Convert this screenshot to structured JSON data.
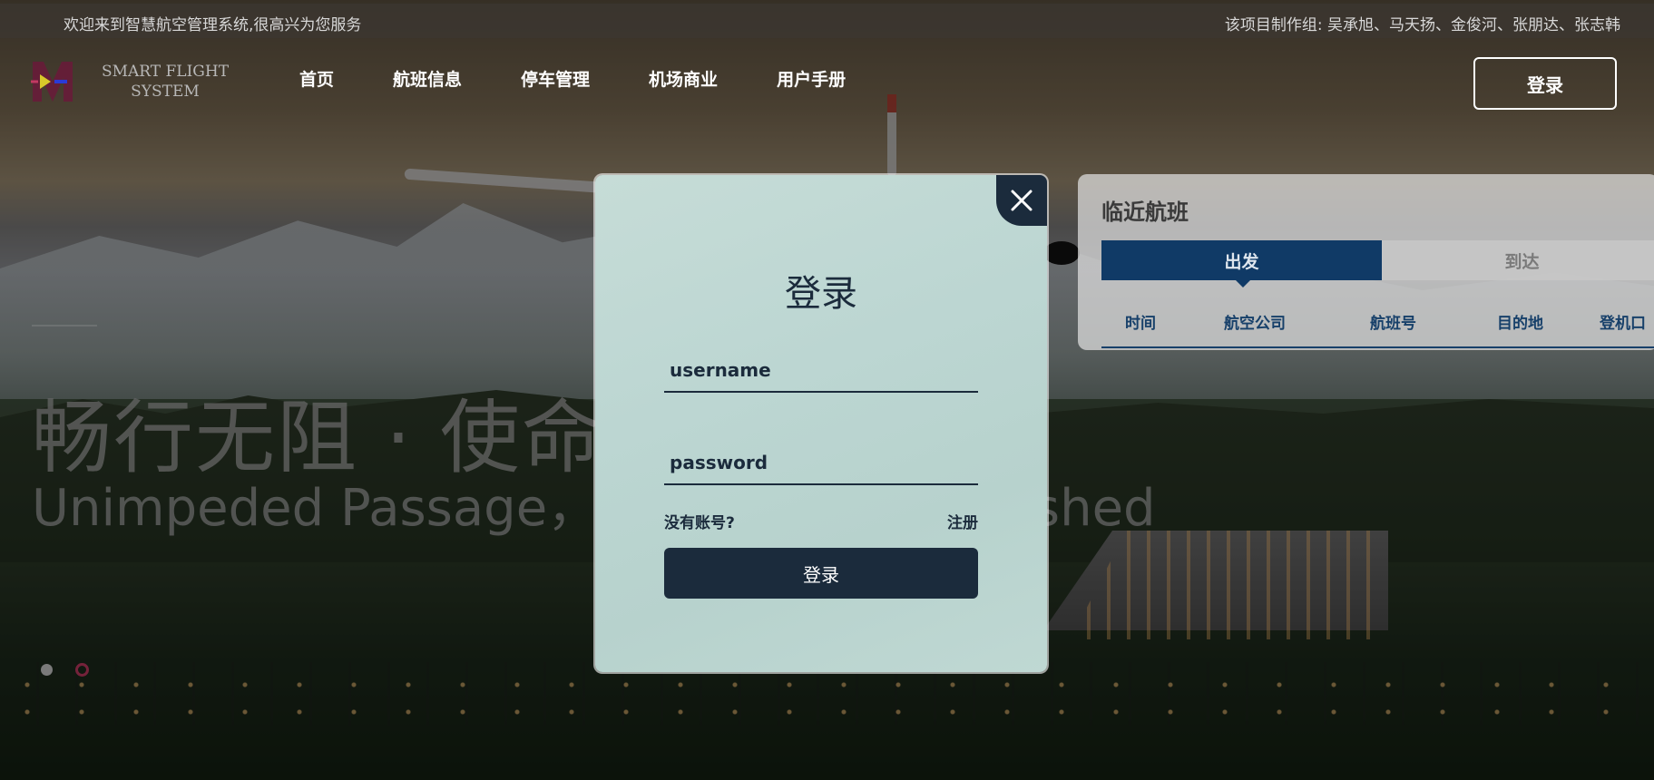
{
  "topbar": {
    "welcome": "欢迎来到智慧航空管理系统,很高兴为您服务",
    "credits": "该项目制作组:  吴承旭、马天扬、金俊河、张朋达、张志韩"
  },
  "nav": {
    "logo_line1": "SMART FLIGHT",
    "logo_line2": "SYSTEM",
    "items": [
      "首页",
      "航班信息",
      "停车管理",
      "机场商业",
      "用户手册"
    ],
    "login_label": "登录"
  },
  "hero": {
    "slogan_cn": "畅行无阻 · 使命必达",
    "slogan_en": "Unimpeded Passage，Mission Accomplished"
  },
  "flights": {
    "title": "临近航班",
    "tabs": [
      "出发",
      "到达"
    ],
    "active_tab": "出发",
    "columns": [
      "时间",
      "航空公司",
      "航班号",
      "目的地",
      "登机口"
    ]
  },
  "login_modal": {
    "title": "登录",
    "username_placeholder": "username",
    "password_placeholder": "password",
    "no_account": "没有账号?",
    "register": "注册",
    "submit": "登录",
    "close_icon": "close-icon"
  },
  "colors": {
    "modal_bg": "#bcd6d2",
    "primary_dark": "#1b2b3c",
    "tab_active": "#103a66",
    "accent_pink": "#c23a62"
  }
}
